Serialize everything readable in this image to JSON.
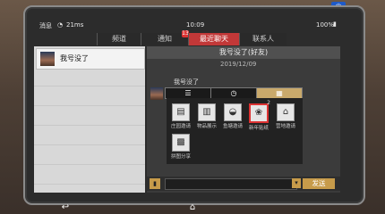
{
  "status": {
    "carrier": "消息",
    "wifi": "21ms",
    "time": "10:09",
    "battery": "100%"
  },
  "tabs": [
    {
      "label": "频道"
    },
    {
      "label": "通知",
      "badge": "13"
    },
    {
      "label": "最近聊天"
    },
    {
      "label": "联系人"
    }
  ],
  "chat_list": [
    {
      "name": "我号没了"
    }
  ],
  "conversation": {
    "header": "我号没了(好友)",
    "date": "2019/12/09",
    "sender": "我号没了"
  },
  "segments": [
    {
      "icon_name": "list-icon",
      "glyph": "☰"
    },
    {
      "icon_name": "clock-icon",
      "glyph": "◷"
    },
    {
      "icon_name": "apps-icon",
      "glyph": "▦"
    }
  ],
  "actions": [
    {
      "label": "庄园邀请",
      "icon_name": "manor-icon",
      "glyph": "▤"
    },
    {
      "label": "物品展示",
      "icon_name": "items-icon",
      "glyph": "▥"
    },
    {
      "label": "鱼塘邀请",
      "icon_name": "fishpond-icon",
      "glyph": "◒"
    },
    {
      "label": "新年贴纸",
      "icon_name": "sticker-icon",
      "glyph": "❀",
      "count": "2"
    },
    {
      "label": "营地邀请",
      "icon_name": "camp-icon",
      "glyph": "⌂"
    },
    {
      "label": "拼图分享",
      "icon_name": "puzzle-icon",
      "glyph": "▩"
    }
  ],
  "input": {
    "value": "",
    "send_label": "发送"
  },
  "colors": {
    "active_tab": "#c23838",
    "send_button": "#c79b4a",
    "sticker_highlight": "#dd3333"
  }
}
